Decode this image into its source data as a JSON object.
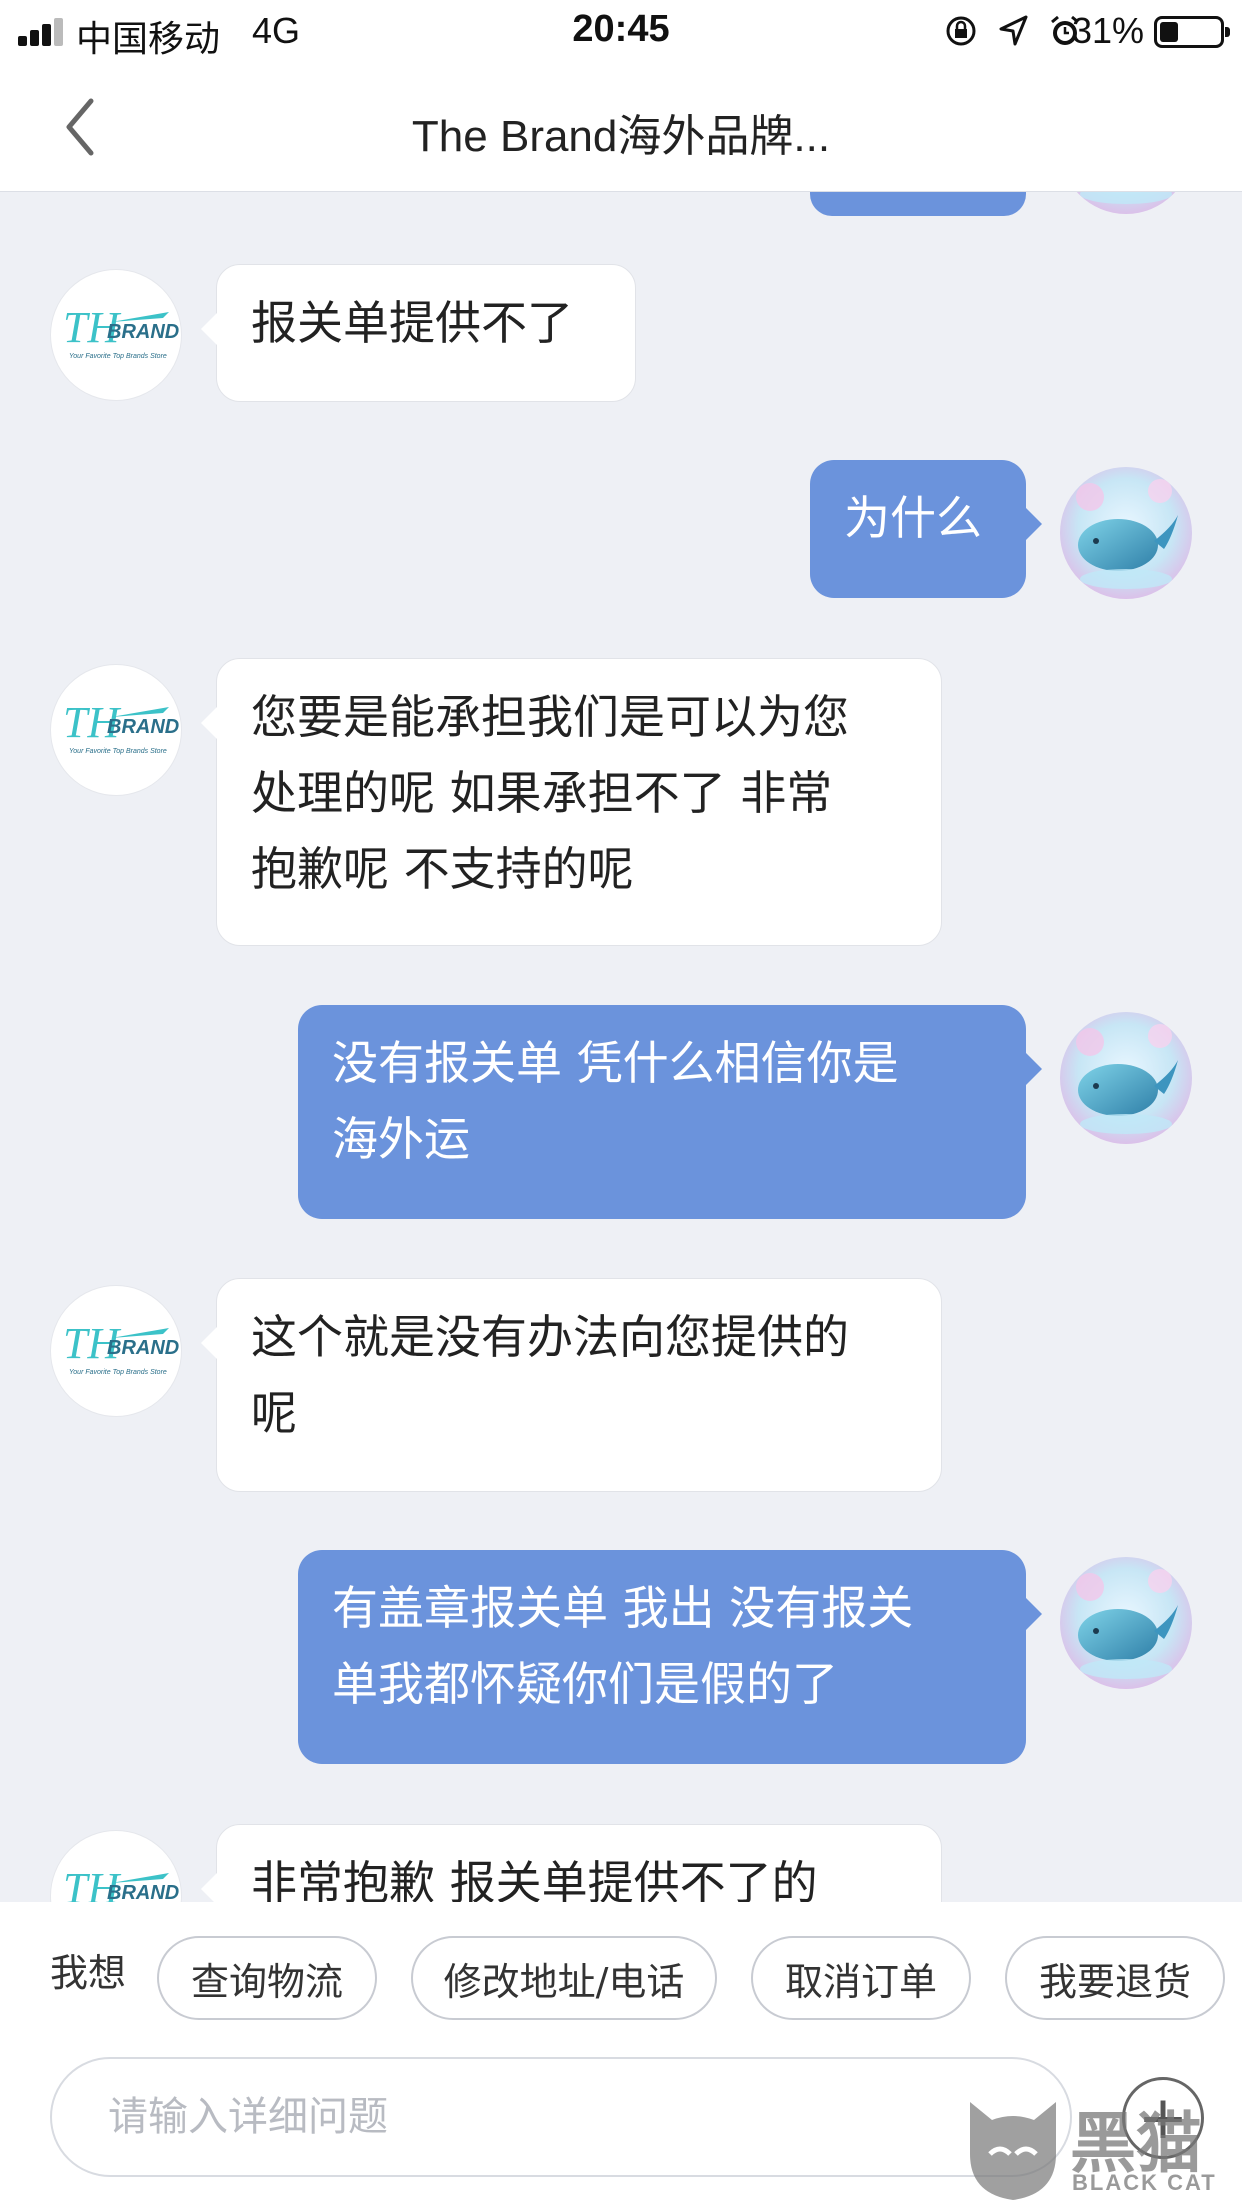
{
  "status_bar": {
    "carrier": "中国移动",
    "network": "4G",
    "time": "20:45",
    "battery": "31%",
    "battery_level": 0.31
  },
  "nav": {
    "title": "The Brand海外品牌..."
  },
  "brand_logo": {
    "name": "THE BRAND",
    "tagline": "Your Favorite Top Brands Store"
  },
  "messages": [
    {
      "from": "agent",
      "text": "报关单提供不了"
    },
    {
      "from": "user",
      "text": "为什么"
    },
    {
      "from": "agent",
      "lines": [
        "您要是能承担我们是可以为您",
        "处理的呢 如果承担不了 非常",
        "抱歉呢 不支持的呢"
      ]
    },
    {
      "from": "user",
      "lines": [
        "没有报关单 凭什么相信你是",
        "海外运"
      ]
    },
    {
      "from": "agent",
      "lines": [
        "这个就是没有办法向您提供的",
        "呢"
      ]
    },
    {
      "from": "user",
      "lines": [
        "有盖章报关单 我出 没有报关",
        "单我都怀疑你们是假的了"
      ]
    },
    {
      "from": "agent",
      "text": "非常抱歉 报关单提供不了的"
    }
  ],
  "quick_replies": {
    "label": "我想",
    "options": [
      "查询物流",
      "修改地址/电话",
      "取消订单",
      "我要退货"
    ]
  },
  "input": {
    "placeholder": "请输入详细问题"
  },
  "watermark": {
    "text": "黑猫",
    "sub": "BLACK CAT"
  },
  "colors": {
    "user_bubble": "#6b93dc",
    "agent_bubble": "#ffffff",
    "background": "#eef0f5",
    "brand_teal": "#3cc2c8"
  }
}
